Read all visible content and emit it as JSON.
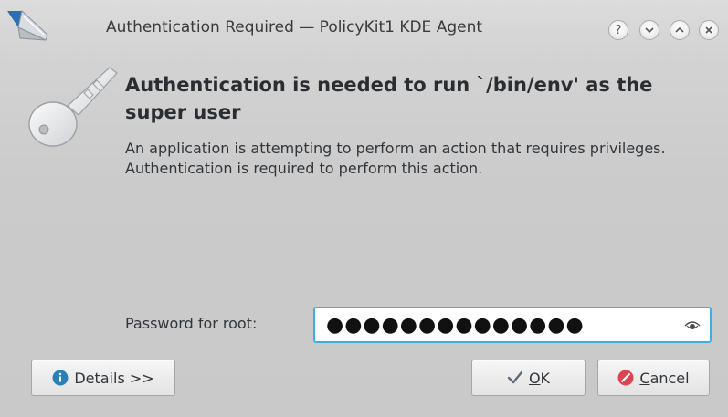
{
  "window": {
    "title": "Authentication Required — PolicyKit1 KDE Agent"
  },
  "titlebar_buttons": [
    {
      "name": "help",
      "glyph": "?"
    },
    {
      "name": "minimize",
      "glyph": "⌄"
    },
    {
      "name": "maximize",
      "glyph": "⌃"
    },
    {
      "name": "close",
      "glyph": "✕"
    }
  ],
  "dialog": {
    "heading": "Authentication is needed to run `/bin/env' as the super user",
    "message": "An application is attempting to perform an action that requires privileges. Authentication is required to perform this action.",
    "password_label": "Password for root:",
    "password_value": "●●●●●●●●●●●●●●"
  },
  "buttons": {
    "details": "Details >>",
    "ok": "OK",
    "cancel": "Cancel"
  },
  "icons": {
    "app": "pen-icon",
    "dialog": "key-icon",
    "details": "info-icon",
    "ok": "checkmark-icon",
    "cancel": "cancel-icon",
    "reveal_password": "eye-icon"
  },
  "colors": {
    "focus_border": "#3daee9",
    "info_blue": "#2980b9",
    "cancel_red": "#da4453"
  }
}
